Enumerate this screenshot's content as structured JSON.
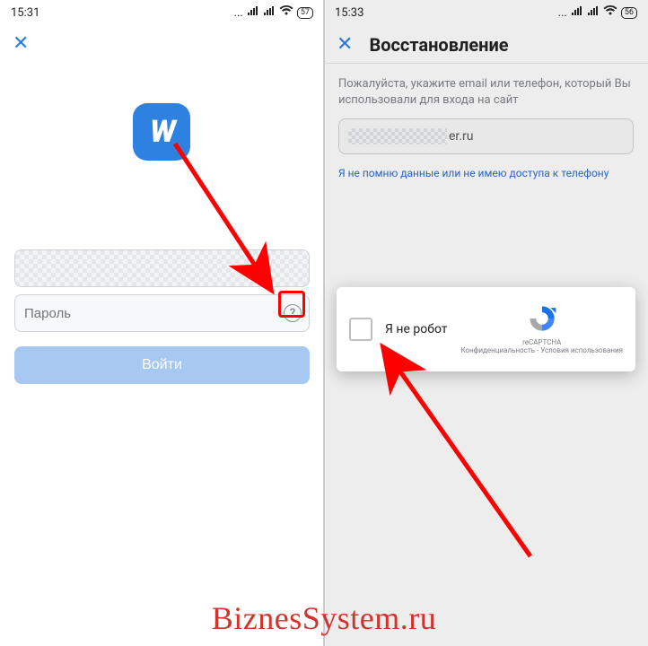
{
  "left": {
    "time": "15:31",
    "battery": "57",
    "password_placeholder": "Пароль",
    "login_label": "Войти"
  },
  "right": {
    "time": "15:33",
    "battery": "56",
    "title": "Восстановление",
    "instruction": "Пожалуйста, укажите email или телефон, который Вы использовали для входа на сайт",
    "email_suffix": "er.ru",
    "forgot_link": "Я не помню данные или не имею доступа к телефону",
    "captcha_label": "Я не робот",
    "recaptcha_brand": "reCAPTCHA",
    "privacy": "Конфиденциальность",
    "terms": "Условия использования"
  },
  "watermark": "BiznesSystem.ru"
}
